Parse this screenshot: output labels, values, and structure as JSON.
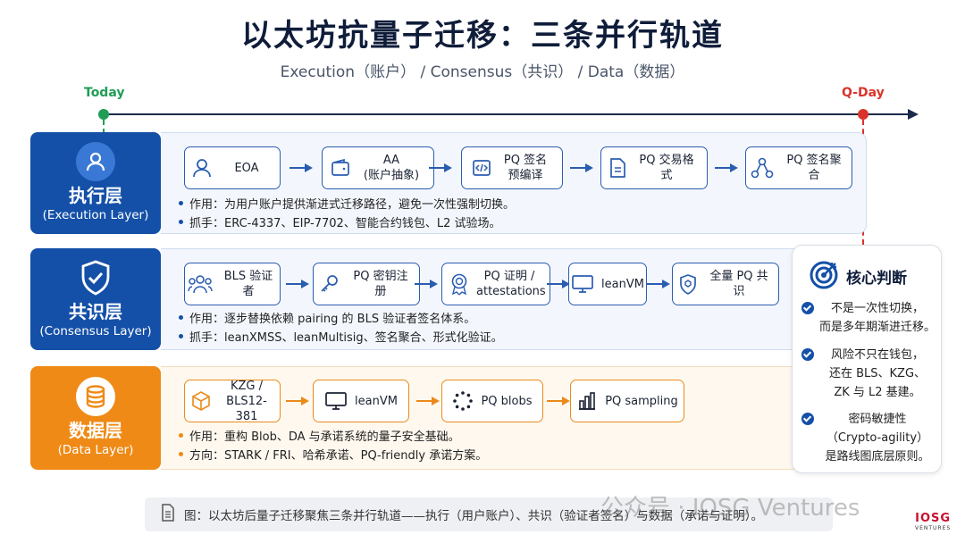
{
  "title": "以太坊抗量子迁移：三条并行轨道",
  "subtitle": "Execution（账户） / Consensus（共识） / Data（数据）",
  "timeline": {
    "start": "Today",
    "end": "Q-Day"
  },
  "lanes": {
    "execution": {
      "name": "执行层",
      "name_en": "(Execution Layer)",
      "icon": "user-icon",
      "steps": [
        "EOA",
        "AA\n(账户抽象)",
        "PQ 签名\n预编译",
        "PQ 交易格式",
        "PQ 签名聚合"
      ],
      "notes": [
        "作用：为用户账户提供渐进式迁移路径，避免一次性强制切换。",
        "抓手：ERC-4337、EIP-7702、智能合约钱包、L2 试验场。"
      ]
    },
    "consensus": {
      "name": "共识层",
      "name_en": "(Consensus Layer)",
      "icon": "shield-check-icon",
      "steps": [
        "BLS 验证者",
        "PQ 密钥注册",
        "PQ 证明 /\nattestations",
        "leanVM",
        "全量 PQ 共识"
      ],
      "notes": [
        "作用：逐步替换依赖 pairing 的 BLS 验证者签名体系。",
        "抓手：leanXMSS、leanMultisig、签名聚合、形式化验证。"
      ]
    },
    "data": {
      "name": "数据层",
      "name_en": "(Data Layer)",
      "icon": "database-icon",
      "steps": [
        "KZG /\nBLS12-381",
        "leanVM",
        "PQ blobs",
        "PQ sampling"
      ],
      "notes": [
        "作用：重构 Blob、DA 与承诺系统的量子安全基础。",
        "方向：STARK / FRI、哈希承诺、PQ-friendly 承诺方案。"
      ]
    }
  },
  "panel": {
    "title": "核心判断",
    "points": [
      "不是一次性切换，\n而是多年期渐进迁移。",
      "风险不只在钱包，\n还在 BLS、KZG、\nZK 与 L2 基建。",
      "密码敏捷性\n（Crypto-agility）\n是路线图底层原则。"
    ]
  },
  "caption": "图：以太坊后量子迁移聚焦三条并行轨道——执行（用户账户）、共识（验证者签名）与数据（承诺与证明）。",
  "watermark": "公众号 · IOSG Ventures",
  "logo": {
    "main": "IOSG",
    "sub": "VENTURES"
  },
  "colors": {
    "blue": "#1450a8",
    "orange": "#ef8a16",
    "green": "#1f9d55",
    "red": "#d9342b"
  }
}
